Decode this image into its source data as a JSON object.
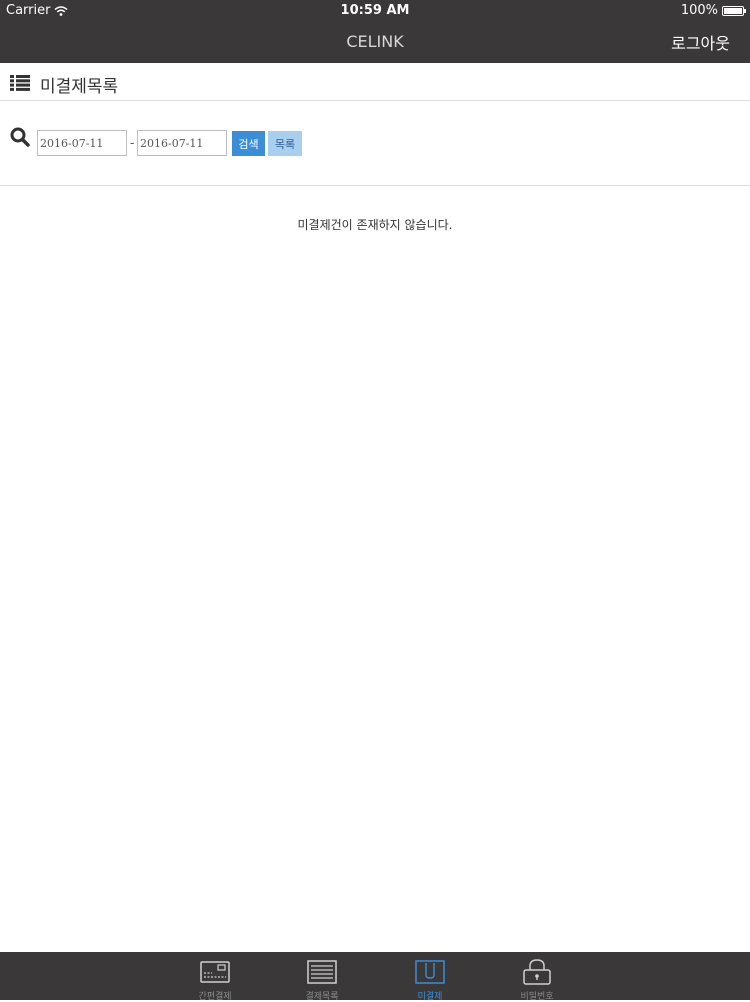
{
  "status_bar": {
    "carrier": "Carrier",
    "time": "10:59 AM",
    "battery": "100%"
  },
  "nav": {
    "title": "CELINK",
    "logout_label": "로그아웃"
  },
  "section": {
    "title": "미결제목록"
  },
  "search": {
    "date_from": "2016-07-11",
    "separator": "-",
    "date_to": "2016-07-11",
    "search_label": "검색",
    "list_label": "목록"
  },
  "main": {
    "empty_message": "미결제건이 존재하지 않습니다."
  },
  "tabs": [
    {
      "label": "간편결제",
      "icon": "card-reader-icon",
      "active": false
    },
    {
      "label": "결제목록",
      "icon": "list-document-icon",
      "active": false
    },
    {
      "label": "미결제",
      "icon": "pending-receipt-icon",
      "active": true
    },
    {
      "label": "비밀번호",
      "icon": "lock-icon",
      "active": false
    }
  ],
  "colors": {
    "bar_background": "#3a3838",
    "accent": "#3b8ed6",
    "list_button": "#a8cef0"
  }
}
